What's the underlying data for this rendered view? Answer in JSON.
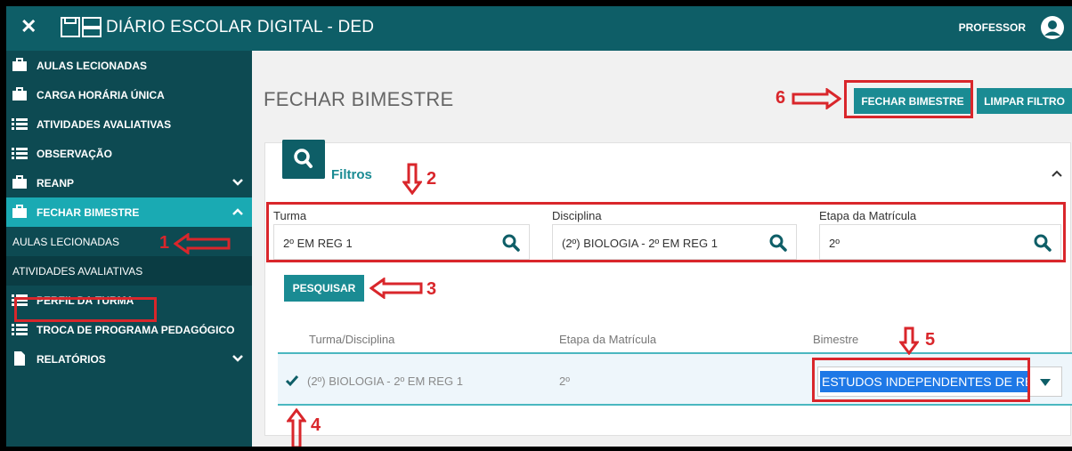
{
  "topbar": {
    "close_icon": "close-icon",
    "title": "DIÁRIO ESCOLAR DIGITAL - DED",
    "user_label": "PROFESSOR"
  },
  "sidebar": {
    "items": [
      {
        "label": "AULAS LECIONADAS",
        "icon": "briefcase-icon"
      },
      {
        "label": "CARGA HORÁRIA ÚNICA",
        "icon": "briefcase-icon"
      },
      {
        "label": "ATIVIDADES AVALIATIVAS",
        "icon": "list-icon"
      },
      {
        "label": "OBSERVAÇÃO",
        "icon": "list-icon"
      },
      {
        "label": "REANP",
        "icon": "briefcase-icon"
      },
      {
        "label": "FECHAR BIMESTRE",
        "icon": "briefcase-icon"
      },
      {
        "label": "PERFIL DA TURMA",
        "icon": "list-icon"
      },
      {
        "label": "TROCA DE PROGRAMA PEDAGÓGICO",
        "icon": "list-icon"
      },
      {
        "label": "RELATÓRIOS",
        "icon": "document-icon"
      }
    ],
    "submenu": [
      {
        "label": "AULAS LECIONADAS"
      },
      {
        "label": "ATIVIDADES AVALIATIVAS"
      }
    ]
  },
  "main": {
    "page_title": "FECHAR BIMESTRE",
    "btn_fechar": "FECHAR BIMESTRE",
    "btn_limpar": "LIMPAR FILTRO",
    "filtros_label": "Filtros",
    "fields": [
      {
        "label": "Turma",
        "value": "2º EM REG 1"
      },
      {
        "label": "Disciplina",
        "value": "(2º) BIOLOGIA - 2º EM REG 1"
      },
      {
        "label": "Etapa da Matrícula",
        "value": "2º"
      }
    ],
    "btn_pesquisar": "PESQUISAR",
    "table": {
      "headers": [
        "Turma/Disciplina",
        "Etapa da Matrícula",
        "Bimestre"
      ],
      "row": {
        "turma_disciplina": "(2º) BIOLOGIA - 2º EM REG 1",
        "etapa": "2º",
        "bimestre": "ESTUDOS INDEPENDENTES DE REG",
        "checked": true
      }
    }
  },
  "annotations": [
    "1",
    "2",
    "3",
    "4",
    "5",
    "6"
  ],
  "colors": {
    "header": "#0e5e67",
    "sidebar": "#0d4a52",
    "active": "#1aaab3",
    "button": "#1a8b93",
    "annotation": "#d9262b"
  }
}
